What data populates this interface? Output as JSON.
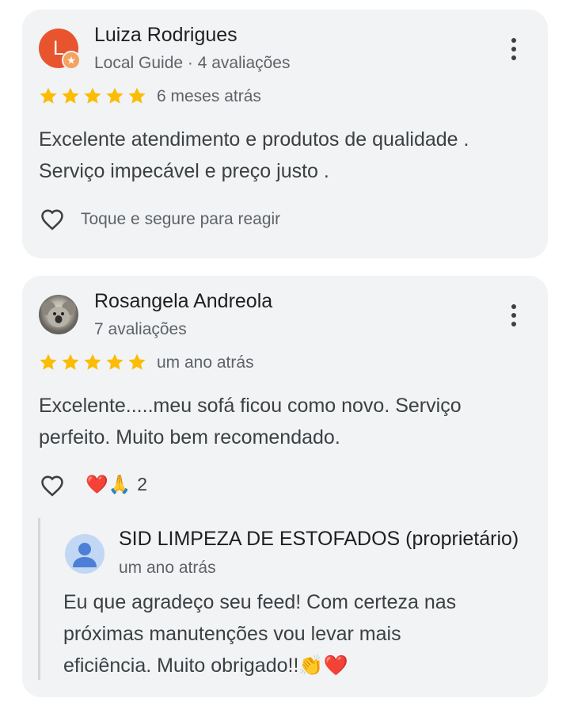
{
  "reviews": [
    {
      "author": "Luiza Rodrigues",
      "avatar_letter": "L",
      "subline": "Local Guide · 4 avaliações",
      "rating": 5,
      "date": "6 meses atrás",
      "text_lines": [
        "Excelente atendimento e produtos de qualidade .",
        "Serviço impecável e preço justo ."
      ],
      "react_hint": "Toque e segure para reagir"
    },
    {
      "author": "Rosangela Andreola",
      "subline": "7 avaliações",
      "rating": 5,
      "date": "um ano atrás",
      "text_lines": [
        "Excelente.....meu sofá ficou como novo. Serviço",
        "perfeito. Muito bem recomendado."
      ],
      "reactions": "❤️🙏",
      "reaction_count": "2",
      "owner_reply": {
        "name": "SID LIMPEZA DE ESTOFADOS (proprietário)",
        "date": "um ano atrás",
        "text_lines": [
          "Eu que agradeço seu feed! Com certeza nas",
          "próximas manutenções vou levar mais",
          "eficiência. Muito obrigado!!👏❤️"
        ]
      }
    }
  ],
  "colors": {
    "star": "#fbbc04",
    "avatar_orange": "#e8542e",
    "card_bg": "#f1f3f4"
  },
  "icons": [
    "heart-outline-icon",
    "more-vert-icon",
    "star-icon",
    "local-guide-badge-icon",
    "person-icon"
  ]
}
